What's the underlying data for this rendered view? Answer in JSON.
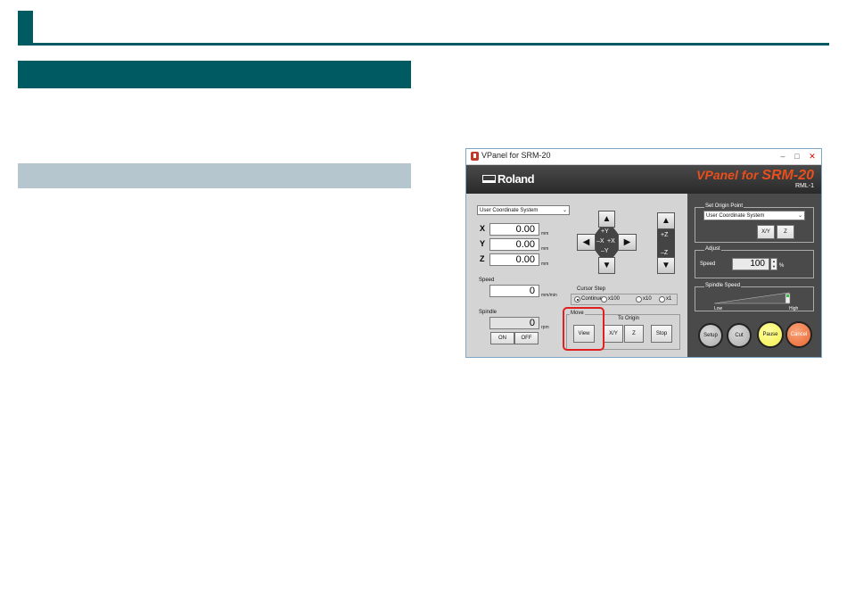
{
  "window": {
    "title": "VPanel for SRM-20",
    "minimize": "–",
    "maximize": "□",
    "close": "✕"
  },
  "banner": {
    "brand": "Roland",
    "product_prefix": "VPanel for ",
    "product_model": "SRM-20",
    "model_code": "RML-1"
  },
  "coords": {
    "system": "User Coordinate System",
    "x_label": "X",
    "x_value": "0.00",
    "y_label": "Y",
    "y_value": "0.00",
    "z_label": "Z",
    "z_value": "0.00",
    "unit": "mm"
  },
  "speed": {
    "label": "Speed",
    "value": "0",
    "unit": "mm/min"
  },
  "spindle": {
    "label": "Spindle",
    "value": "0",
    "unit": "rpm",
    "on": "ON",
    "off": "OFF"
  },
  "jog": {
    "up": "▲",
    "down": "▼",
    "left": "◀",
    "right": "▶",
    "plus_y": "+Y",
    "minus_x": "–X",
    "plus_x": "+X",
    "minus_y": "–Y",
    "z_up": "▲",
    "z_down": "▼",
    "plus_z": "+Z",
    "minus_z": "–Z"
  },
  "cursor_step": {
    "label": "Cursor Step",
    "options": [
      "Continue",
      "x100",
      "x10",
      "x1"
    ],
    "selected": "Continue"
  },
  "move": {
    "label": "Move",
    "view": "View",
    "to_origin": "To Origin",
    "xy": "X/Y",
    "z": "Z",
    "stop": "Stop"
  },
  "origin": {
    "label": "Set Origin Point",
    "system": "User Coordinate System",
    "xy": "X/Y",
    "z": "Z"
  },
  "adjust": {
    "label": "Adjust",
    "speed_label": "Speed",
    "speed_value": "100",
    "unit": "%"
  },
  "spindle_speed": {
    "label": "Spindle Speed",
    "low": "Low",
    "high": "High",
    "level": 1.0
  },
  "actions": {
    "setup": "Setup",
    "cut": "Cut",
    "pause": "Pause",
    "cancel": "Cancel"
  },
  "colors": {
    "accent": "#005a62",
    "sub_bar": "#b6c6cf",
    "highlight": "#e02020",
    "model_red": "#e94e1b"
  }
}
